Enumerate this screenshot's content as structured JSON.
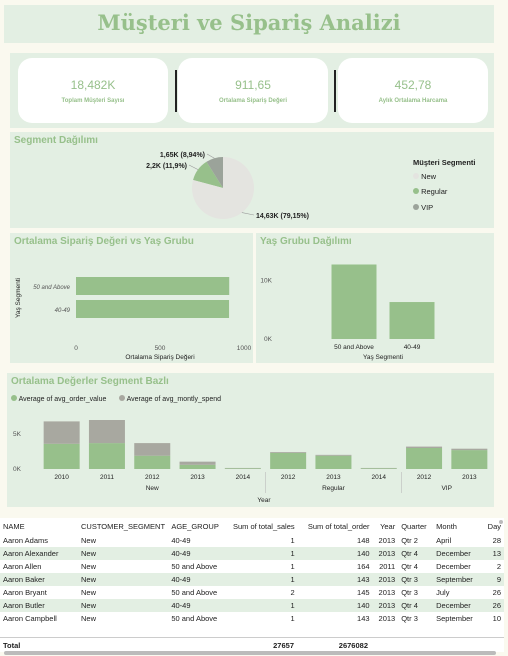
{
  "page_title": "Müşteri  ve Sipariş Analizi",
  "kpis": [
    {
      "value": "18,482K",
      "label": "Toplam Müşteri Sayısı"
    },
    {
      "value": "911,65",
      "label": "Ortalama Sipariş Değeri"
    },
    {
      "value": "452,78",
      "label": "Aylık Ortalama Harcama"
    }
  ],
  "colors": {
    "new": "#e4e4e0",
    "regular": "#97c08b",
    "vip": "#9ba39a",
    "series_alt": "#a8a8a0",
    "accent": "#97c08b"
  },
  "chart_data": [
    {
      "type": "pie",
      "title": "Segment Dağılımı",
      "legend_title": "Müşteri Segmenti",
      "legend_position": "right",
      "categories": [
        "New",
        "Regular",
        "VIP"
      ],
      "values": [
        14630,
        2200,
        1650
      ],
      "data_labels": [
        "14,63K (79,15%)",
        "2,2K (11,9%)",
        "1,65K (8,94%)"
      ]
    },
    {
      "type": "bar",
      "orientation": "horizontal",
      "title": "Ortalama Sipariş Değeri vs Yaş Grubu",
      "categories": [
        "50 and Above",
        "40-49"
      ],
      "values": [
        912,
        911
      ],
      "xlabel": "Ortalama Sipariş Değeri",
      "ylabel": "Yaş Segmenti",
      "xlim": [
        0,
        1000
      ],
      "xticks": [
        "0",
        "500",
        "1000"
      ]
    },
    {
      "type": "bar",
      "title": "Yaş Grubu Dağılımı",
      "categories": [
        "50 and Above",
        "40-49"
      ],
      "values": [
        12700,
        6300
      ],
      "xlabel": "Yaş Segmenti",
      "ylabel": "",
      "ylim": [
        0,
        15000
      ],
      "yticks": [
        "10K",
        "0K"
      ]
    },
    {
      "type": "bar",
      "stacked": true,
      "title": "Ortalama Değerler Segment Bazlı",
      "legend_position": "top-left",
      "xlabel": "Year",
      "ylabel": "",
      "ylim": [
        0,
        8000
      ],
      "yticks": [
        "5K",
        "0K"
      ],
      "groups": [
        {
          "name": "New",
          "years": [
            "2010",
            "2011",
            "2012",
            "2013",
            "2014"
          ]
        },
        {
          "name": "Regular",
          "years": [
            "2012",
            "2013",
            "2014"
          ]
        },
        {
          "name": "VIP",
          "years": [
            "2012",
            "2013"
          ]
        }
      ],
      "series": [
        {
          "name": "Average of avg_order_value",
          "values": [
            3600,
            3700,
            1900,
            600,
            100,
            2300,
            1900,
            100,
            3000,
            2700
          ]
        },
        {
          "name": "Average of avg_montly_spend",
          "values": [
            3200,
            3300,
            1800,
            450,
            50,
            120,
            120,
            50,
            200,
            200
          ]
        }
      ]
    },
    {
      "type": "table",
      "columns": [
        "NAME",
        "CUSTOMER_SEGMENT",
        "AGE_GROUP",
        "Sum of total_sales",
        "Sum of total_order",
        "Year",
        "Quarter",
        "Month",
        "Day"
      ],
      "rows": [
        [
          "Aaron Adams",
          "New",
          "40-49",
          "1",
          "148",
          "2013",
          "Qtr 2",
          "April",
          "28"
        ],
        [
          "Aaron Alexander",
          "New",
          "40-49",
          "1",
          "140",
          "2013",
          "Qtr 4",
          "December",
          "13"
        ],
        [
          "Aaron Allen",
          "New",
          "50 and Above",
          "1",
          "164",
          "2011",
          "Qtr 4",
          "December",
          "2"
        ],
        [
          "Aaron Baker",
          "New",
          "40-49",
          "1",
          "143",
          "2013",
          "Qtr 3",
          "September",
          "9"
        ],
        [
          "Aaron Bryant",
          "New",
          "50 and Above",
          "2",
          "145",
          "2013",
          "Qtr 3",
          "July",
          "26"
        ],
        [
          "Aaron Butler",
          "New",
          "40-49",
          "1",
          "140",
          "2013",
          "Qtr 4",
          "December",
          "26"
        ],
        [
          "Aaron Campbell",
          "New",
          "50 and Above",
          "1",
          "143",
          "2013",
          "Qtr 3",
          "September",
          "10"
        ]
      ],
      "total": {
        "label": "Total",
        "sum_total_sales": "27657",
        "sum_total_order": "2676082"
      }
    }
  ]
}
